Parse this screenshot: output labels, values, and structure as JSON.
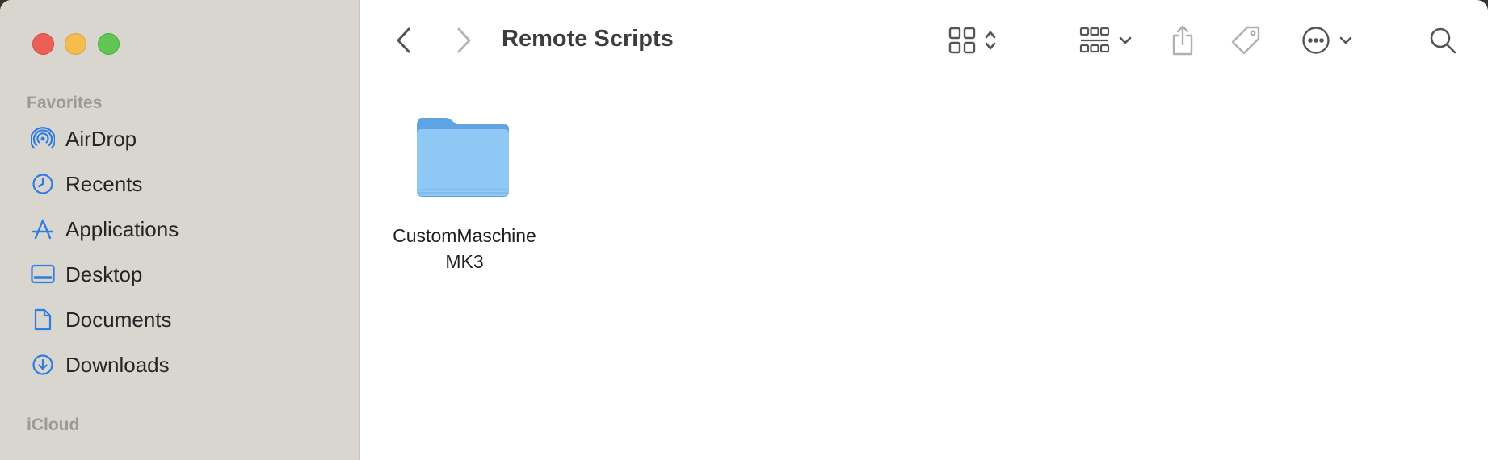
{
  "window": {
    "title": "Remote Scripts"
  },
  "sidebar": {
    "favorites_label": "Favorites",
    "items": [
      {
        "label": "AirDrop",
        "icon": "airdrop-icon"
      },
      {
        "label": "Recents",
        "icon": "clock-icon"
      },
      {
        "label": "Applications",
        "icon": "applications-icon"
      },
      {
        "label": "Desktop",
        "icon": "desktop-icon"
      },
      {
        "label": "Documents",
        "icon": "document-icon"
      },
      {
        "label": "Downloads",
        "icon": "download-icon"
      }
    ],
    "icloud_label": "iCloud"
  },
  "toolbar": {
    "back": "chevron-left-icon",
    "forward": "chevron-right-icon",
    "view_mode": "grid-view-icon",
    "group": "group-icon",
    "share": "share-icon",
    "tag": "tag-icon",
    "more": "more-icon",
    "search": "search-icon"
  },
  "content": {
    "items": [
      {
        "name_line1": "CustomMaschine",
        "name_line2": "MK3",
        "icon": "folder-icon"
      }
    ]
  },
  "colors": {
    "accent": "#2f7de1",
    "sidebar_bg": "#d9d6d0",
    "folder": "#8fc8f5"
  }
}
